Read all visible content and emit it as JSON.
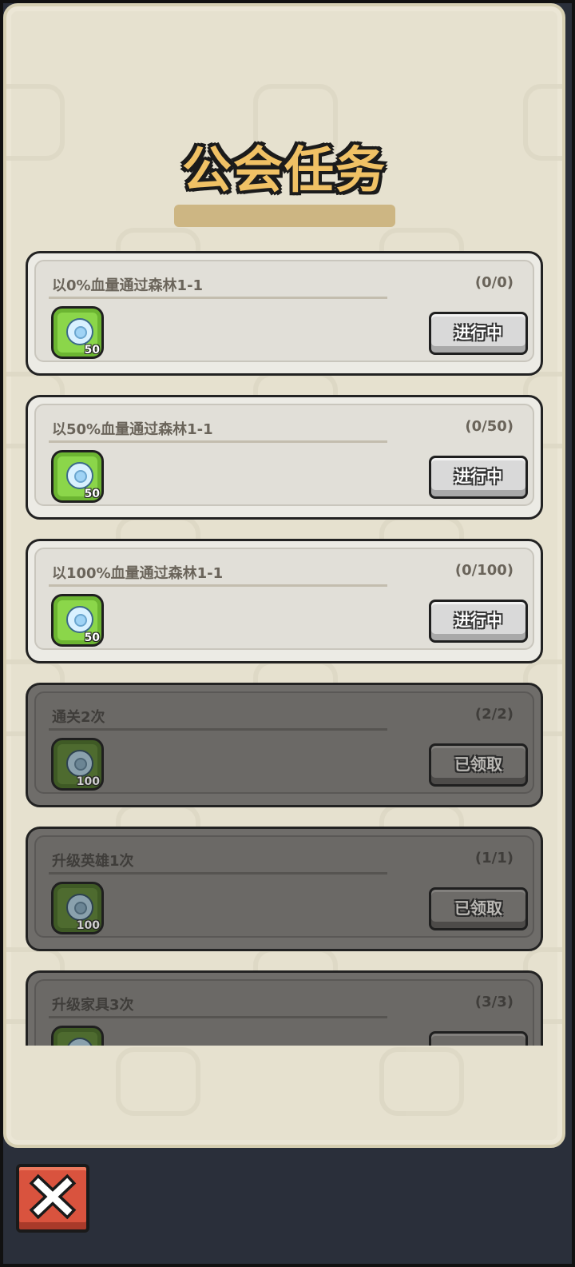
{
  "header": {
    "title": "公会任务"
  },
  "quests": [
    {
      "name": "以0%血量通过森林1-1",
      "progress": "(0/0)",
      "reward_qty": "50",
      "status": "进行中",
      "done": false
    },
    {
      "name": "以50%血量通过森林1-1",
      "progress": "(0/50)",
      "reward_qty": "50",
      "status": "进行中",
      "done": false
    },
    {
      "name": "以100%血量通过森林1-1",
      "progress": "(0/100)",
      "reward_qty": "50",
      "status": "进行中",
      "done": false
    },
    {
      "name": "通关2次",
      "progress": "(2/2)",
      "reward_qty": "100",
      "status": "已领取",
      "done": true
    },
    {
      "name": "升级英雄1次",
      "progress": "(1/1)",
      "reward_qty": "100",
      "status": "已领取",
      "done": true
    },
    {
      "name": "升级家具3次",
      "progress": "(3/3)",
      "reward_qty": "",
      "status": "",
      "done": true
    }
  ],
  "icons": {
    "reward": "gem-icon",
    "close": "close-icon"
  },
  "colors": {
    "title": "#f0c165",
    "close_button": "#d9533e",
    "reward_tile": "#8bd64a"
  }
}
